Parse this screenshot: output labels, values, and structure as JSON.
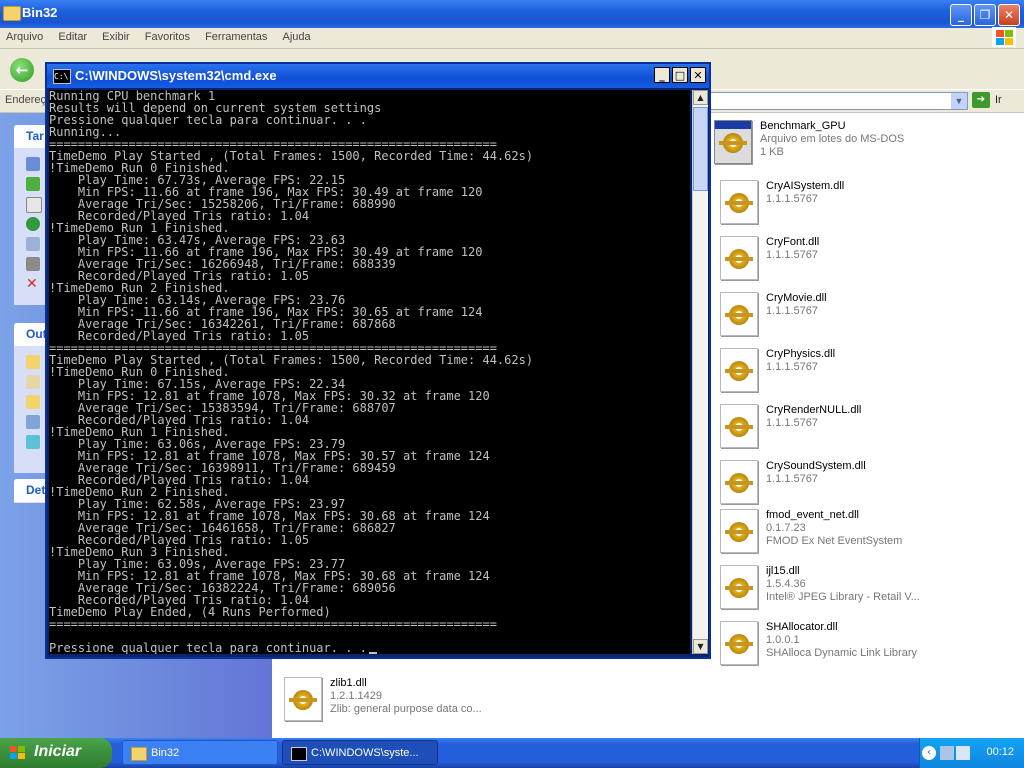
{
  "explorer": {
    "title": "Bin32",
    "menu": [
      "Arquivo",
      "Editar",
      "Exibir",
      "Favoritos",
      "Ferramentas",
      "Ajuda"
    ],
    "address_label": "Endereço",
    "go_label": "Ir",
    "task_headers": [
      "Tar",
      "Out",
      "Det"
    ],
    "files": [
      {
        "name": "Benchmark_GPU",
        "line2": "Arquivo em lotes do MS-DOS",
        "line3": "1 KB"
      },
      {
        "name": "CryAISystem.dll",
        "line2": "1.1.1.5767",
        "line3": ""
      },
      {
        "name": "CryFont.dll",
        "line2": "1.1.1.5767",
        "line3": ""
      },
      {
        "name": "CryMovie.dll",
        "line2": "1.1.1.5767",
        "line3": ""
      },
      {
        "name": "CryPhysics.dll",
        "line2": "1.1.1.5767",
        "line3": ""
      },
      {
        "name": "CryRenderNULL.dll",
        "line2": "1.1.1.5767",
        "line3": ""
      },
      {
        "name": "CrySoundSystem.dll",
        "line2": "1.1.1.5767",
        "line3": ""
      },
      {
        "name": "fmod_event_net.dll",
        "line2": "0.1.7.23",
        "line3": "FMOD Ex Net EventSystem"
      },
      {
        "name": "ijl15.dll",
        "line2": "1.5.4.36",
        "line3": "Intel® JPEG Library - Retail V..."
      },
      {
        "name": "SHAllocator.dll",
        "line2": "1.0.0.1",
        "line3": "SHAlloca Dynamic Link Library"
      },
      {
        "name": "zlib1.dll",
        "line2": "1.2.1.1429",
        "line3": "Zlib: general purpose data co..."
      }
    ]
  },
  "cmd": {
    "title": "C:\\WINDOWS\\system32\\cmd.exe",
    "lines": [
      "Running CPU benchmark 1",
      "Results will depend on current system settings",
      "Pressione qualquer tecla para continuar. . .",
      "Running...",
      "==============================================================",
      "TimeDemo Play Started , (Total Frames: 1500, Recorded Time: 44.62s)",
      "!TimeDemo Run 0 Finished.",
      "    Play Time: 67.73s, Average FPS: 22.15",
      "    Min FPS: 11.66 at frame 196, Max FPS: 30.49 at frame 120",
      "    Average Tri/Sec: 15258206, Tri/Frame: 688990",
      "    Recorded/Played Tris ratio: 1.04",
      "!TimeDemo Run 1 Finished.",
      "    Play Time: 63.47s, Average FPS: 23.63",
      "    Min FPS: 11.66 at frame 196, Max FPS: 30.49 at frame 120",
      "    Average Tri/Sec: 16266948, Tri/Frame: 688339",
      "    Recorded/Played Tris ratio: 1.05",
      "!TimeDemo Run 2 Finished.",
      "    Play Time: 63.14s, Average FPS: 23.76",
      "    Min FPS: 11.66 at frame 196, Max FPS: 30.65 at frame 124",
      "    Average Tri/Sec: 16342261, Tri/Frame: 687868",
      "    Recorded/Played Tris ratio: 1.05",
      "==============================================================",
      "TimeDemo Play Started , (Total Frames: 1500, Recorded Time: 44.62s)",
      "!TimeDemo Run 0 Finished.",
      "    Play Time: 67.15s, Average FPS: 22.34",
      "    Min FPS: 12.81 at frame 1078, Max FPS: 30.32 at frame 120",
      "    Average Tri/Sec: 15383594, Tri/Frame: 688707",
      "    Recorded/Played Tris ratio: 1.04",
      "!TimeDemo Run 1 Finished.",
      "    Play Time: 63.06s, Average FPS: 23.79",
      "    Min FPS: 12.81 at frame 1078, Max FPS: 30.57 at frame 124",
      "    Average Tri/Sec: 16398911, Tri/Frame: 689459",
      "    Recorded/Played Tris ratio: 1.04",
      "!TimeDemo Run 2 Finished.",
      "    Play Time: 62.58s, Average FPS: 23.97",
      "    Min FPS: 12.81 at frame 1078, Max FPS: 30.68 at frame 124",
      "    Average Tri/Sec: 16461658, Tri/Frame: 686827",
      "    Recorded/Played Tris ratio: 1.05",
      "!TimeDemo Run 3 Finished.",
      "    Play Time: 63.09s, Average FPS: 23.77",
      "    Min FPS: 12.81 at frame 1078, Max FPS: 30.68 at frame 124",
      "    Average Tri/Sec: 16382224, Tri/Frame: 689056",
      "    Recorded/Played Tris ratio: 1.04",
      "TimeDemo Play Ended, (4 Runs Performed)",
      "==============================================================",
      "",
      "Pressione qualquer tecla para continuar. . ."
    ]
  },
  "taskbar": {
    "start_label": "Iniciar",
    "buttons": [
      "Bin32",
      "C:\\WINDOWS\\syste..."
    ],
    "clock": "00:12"
  },
  "colors": {
    "console_bg": "#000000",
    "console_fg": "#c0c0c0",
    "xp_blue": "#245edb",
    "start_green": "#3c8f3c"
  }
}
